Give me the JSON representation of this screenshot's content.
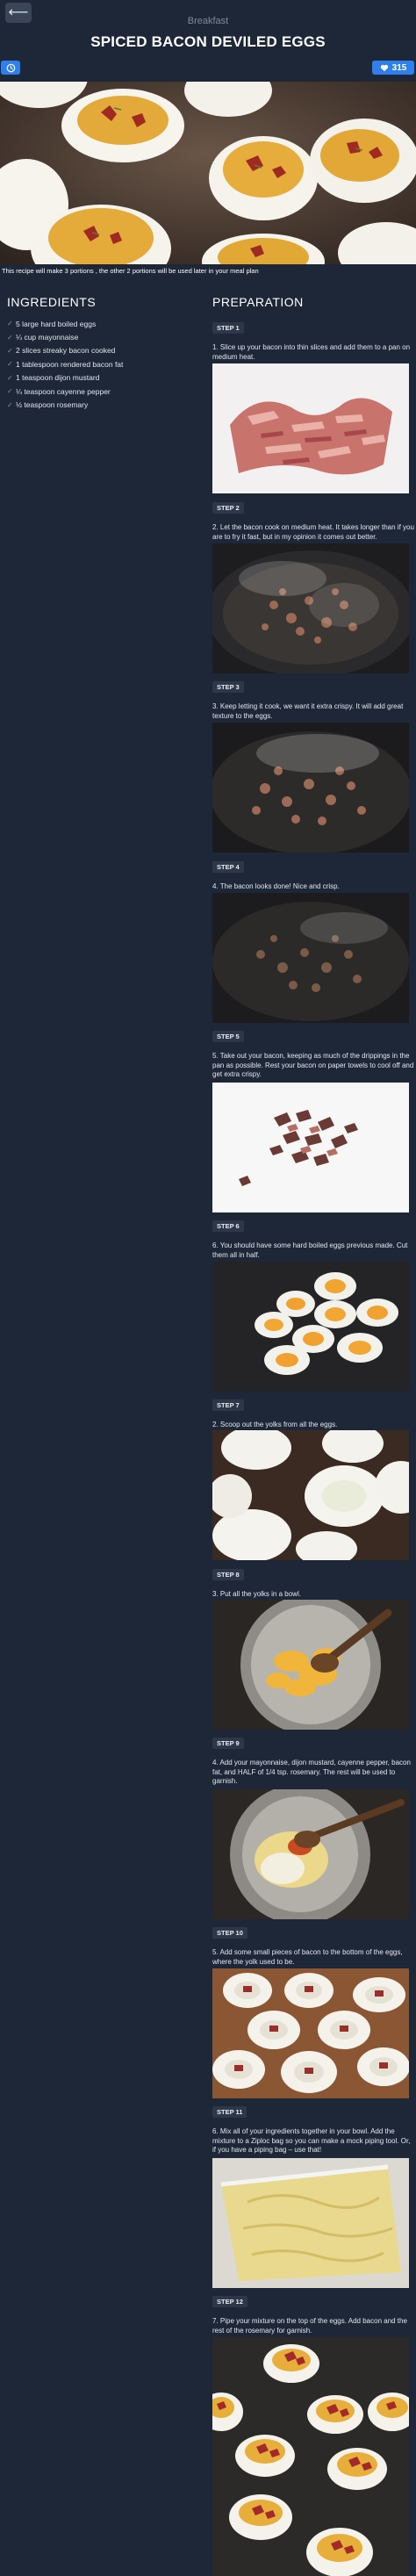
{
  "header": {
    "back_icon": "arrow-left-icon",
    "category": "Breakfast",
    "title": "SPICED BACON DEVILED EGGS",
    "clock_icon": "clock-icon",
    "likes_icon": "heart-icon",
    "likes_count": "315",
    "accent_color": "#2f80ed"
  },
  "hero": {
    "note": "This recipe will make 3 portions , the other 2 portions will be used later in your meal plan"
  },
  "ingredients": {
    "heading": "INGREDIENTS",
    "items": [
      "5 large hard boiled eggs",
      "¼ cup mayonnaise",
      "2 slices streaky bacon cooked",
      "1 tablespoon rendered bacon fat",
      "1 teaspoon dijon mustard",
      "¼ teaspoon cayenne pepper",
      "½ teaspoon rosemary"
    ]
  },
  "preparation": {
    "heading": "PREPARATION",
    "steps": [
      {
        "label": "STEP 1",
        "text": "1. Slice up your bacon into thin slices and add them to a pan on medium heat."
      },
      {
        "label": "STEP 2",
        "text": "2. Let the bacon cook on medium heat. It takes longer than if you are to fry it fast, but in my opinion it comes out better."
      },
      {
        "label": "STEP 3",
        "text": "3. Keep letting it cook, we want it extra crispy. It will add great texture to the eggs."
      },
      {
        "label": "STEP 4",
        "text": "4. The bacon looks done! Nice and crisp."
      },
      {
        "label": "STEP 5",
        "text": "5. Take out your bacon, keeping as much of the drippings in the pan as possible. Rest your bacon on paper towels to cool off and get extra crispy."
      },
      {
        "label": "STEP 6",
        "text": "6. You should have some hard boiled eggs previous made. Cut them all in half."
      },
      {
        "label": "STEP 7",
        "text": "2. Scoop out the yolks from all the eggs."
      },
      {
        "label": "STEP 8",
        "text": "3. Put all the yolks in a bowl."
      },
      {
        "label": "STEP 9",
        "text": "4. Add your mayonnaise, dijon mustard, cayenne pepper, bacon fat, and HALF of 1/4 tsp. rosemary. The rest will be used to garnish."
      },
      {
        "label": "STEP 10",
        "text": "5. Add some small pieces of bacon to the bottom of the eggs, where the yolk used to be."
      },
      {
        "label": "STEP 11",
        "text": "6. Mix all of your ingredients together in your bowl. Add the mixture to a Ziploc bag so you can make a mock piping tool. Or, if you have a piping bag – use that!"
      },
      {
        "label": "STEP 12",
        "text": "7. Pipe your mixture on the top of the eggs. Add bacon and the rest of the rosemary for garnish."
      }
    ]
  }
}
